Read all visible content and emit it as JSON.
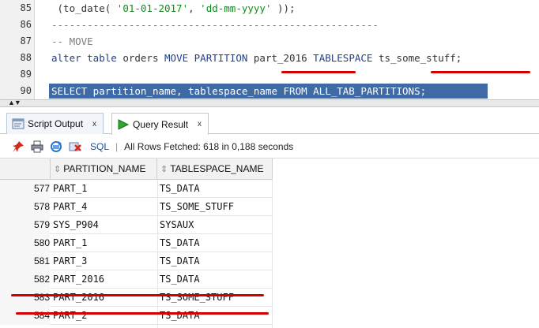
{
  "editor": {
    "lines": [
      {
        "num": "85",
        "tokens": [
          [
            "plain",
            " (to_date( "
          ],
          [
            "str",
            "'01-01-2017'"
          ],
          [
            "plain",
            ", "
          ],
          [
            "str",
            "'dd-mm-yyyy'"
          ],
          [
            "plain",
            " ));"
          ]
        ]
      },
      {
        "num": "86",
        "tokens": [
          [
            "cm",
            "-------------------------------------------------------"
          ]
        ]
      },
      {
        "num": "87",
        "tokens": [
          [
            "cm",
            "-- MOVE"
          ]
        ]
      },
      {
        "num": "88",
        "tokens": [
          [
            "kw",
            "alter table"
          ],
          [
            "plain",
            " orders "
          ],
          [
            "kw",
            "MOVE PARTITION"
          ],
          [
            "plain",
            " part_2016 "
          ],
          [
            "kw",
            "TABLESPACE"
          ],
          [
            "plain",
            " ts_some_stuff;"
          ]
        ]
      },
      {
        "num": "89",
        "tokens": []
      },
      {
        "num": "90",
        "tokens": [
          [
            "kw",
            "SELECT"
          ],
          [
            "plain",
            " partition_name, tablespace_name "
          ],
          [
            "kw",
            "FROM"
          ],
          [
            "plain",
            " ALL_TAB_PARTITIONS;"
          ]
        ]
      }
    ]
  },
  "tabs": [
    {
      "label": "Script Output",
      "close": "x",
      "icon": "script-output-icon"
    },
    {
      "label": "Query Result",
      "close": "x",
      "icon": "run-arrow-icon"
    }
  ],
  "toolbar": {
    "sql_label": "SQL",
    "separator": "|",
    "status": "All Rows Fetched: 618 in 0,188 seconds"
  },
  "grid": {
    "columns": [
      "PARTITION_NAME",
      "TABLESPACE_NAME"
    ],
    "rows": [
      {
        "n": "577",
        "partition": "PART_1",
        "tablespace": "TS_DATA"
      },
      {
        "n": "578",
        "partition": "PART_4",
        "tablespace": "TS_SOME_STUFF"
      },
      {
        "n": "579",
        "partition": "SYS_P904",
        "tablespace": "SYSAUX"
      },
      {
        "n": "580",
        "partition": "PART_1",
        "tablespace": "TS_DATA"
      },
      {
        "n": "581",
        "partition": "PART_3",
        "tablespace": "TS_DATA"
      },
      {
        "n": "582",
        "partition": "PART_2016",
        "tablespace": "TS_DATA"
      },
      {
        "n": "583",
        "partition": "PART_2016",
        "tablespace": "TS_SOME_STUFF"
      },
      {
        "n": "584",
        "partition": "PART_2",
        "tablespace": "TS_DATA"
      }
    ]
  },
  "colors": {
    "highlight": "#3f6aa5",
    "annotation": "#d40000",
    "keyword": "#1e3f8e",
    "string": "#138a1e"
  }
}
